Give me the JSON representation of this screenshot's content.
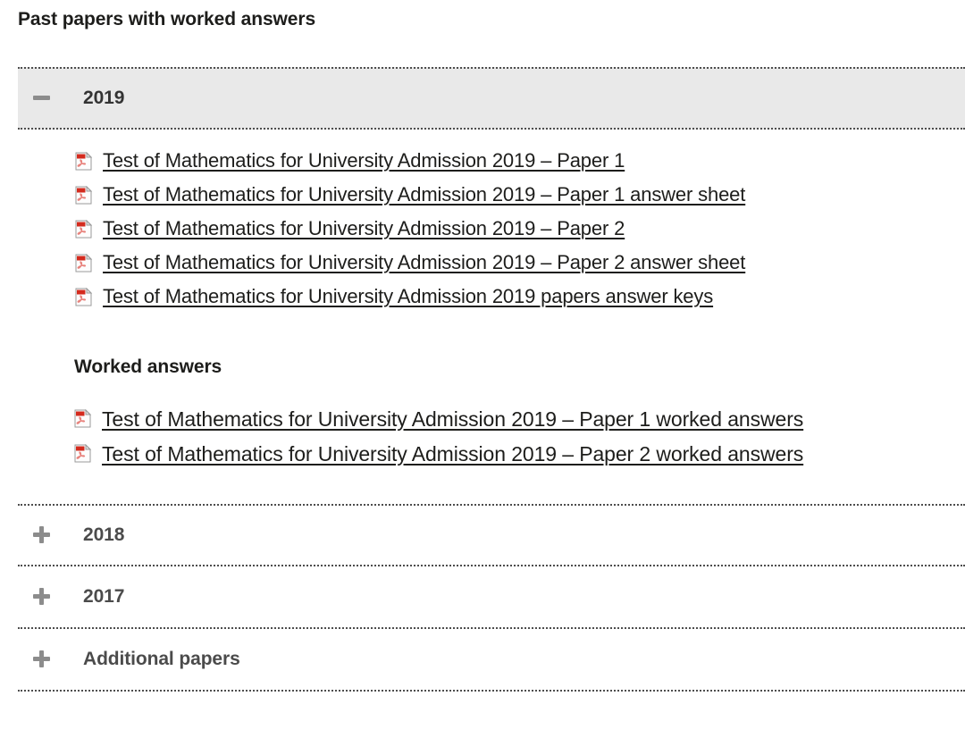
{
  "page": {
    "title": "Past papers with worked answers"
  },
  "accordion": {
    "sections": [
      {
        "label": "2019",
        "state": "expanded",
        "toggle_icon": "minus-icon",
        "papers": [
          {
            "icon": "pdf-icon",
            "label": "Test of Mathematics for University Admission 2019 – Paper 1"
          },
          {
            "icon": "pdf-icon",
            "label": "Test of Mathematics for University Admission 2019 – Paper 1 answer sheet"
          },
          {
            "icon": "pdf-icon",
            "label": "Test of Mathematics for University Admission 2019 – Paper 2"
          },
          {
            "icon": "pdf-icon",
            "label": "Test of Mathematics for University Admission 2019 – Paper 2 answer sheet"
          },
          {
            "icon": "pdf-icon",
            "label": "Test of Mathematics for University Admission 2019 papers answer keys"
          }
        ],
        "worked_heading": "Worked answers",
        "worked": [
          {
            "icon": "pdf-icon",
            "label": "Test of Mathematics for University Admission 2019 – Paper 1 worked answers"
          },
          {
            "icon": "pdf-icon",
            "label": "Test of Mathematics for University Admission 2019 – Paper 2 worked answers"
          }
        ]
      },
      {
        "label": "2018",
        "state": "collapsed",
        "toggle_icon": "plus-icon"
      },
      {
        "label": "2017",
        "state": "collapsed",
        "toggle_icon": "plus-icon"
      },
      {
        "label": "Additional papers",
        "state": "collapsed",
        "toggle_icon": "plus-icon"
      }
    ]
  },
  "colors": {
    "header_open_bg": "#e9e9e9",
    "divider": "#4d4d4d",
    "toggle_gray": "#8c8c8c",
    "link_text": "#1d1d1b",
    "label_gray": "#4b4b4b",
    "pdf_red": "#d42b1e"
  }
}
